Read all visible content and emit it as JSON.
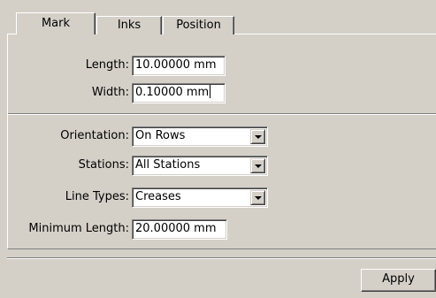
{
  "tabs": [
    {
      "label": "Mark",
      "active": true
    },
    {
      "label": "Inks",
      "active": false
    },
    {
      "label": "Position",
      "active": false
    }
  ],
  "fields": {
    "length": {
      "label": "Length:",
      "value": "10.00000 mm"
    },
    "width": {
      "label": "Width:",
      "value": "0.10000 mm"
    },
    "orientation": {
      "label": "Orientation:",
      "value": "On Rows"
    },
    "stations": {
      "label": "Stations:",
      "value": "All Stations"
    },
    "line_types": {
      "label": "Line Types:",
      "value": "Creases"
    },
    "minimum_length": {
      "label": "Minimum Length:",
      "value": "20.00000 mm"
    }
  },
  "apply_label": "Apply"
}
